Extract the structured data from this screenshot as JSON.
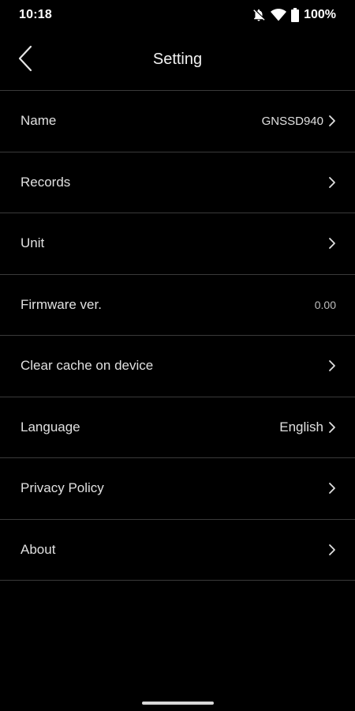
{
  "status_bar": {
    "time": "10:18",
    "battery": "100%",
    "icons": [
      "notifications-off-icon",
      "wifi-icon",
      "battery-icon"
    ]
  },
  "header": {
    "title": "Setting",
    "back_icon": "chevron-left-icon"
  },
  "settings": [
    {
      "label": "Name",
      "value": "GNSSD940",
      "chevron": true
    },
    {
      "label": "Records",
      "value": "",
      "chevron": true
    },
    {
      "label": "Unit",
      "value": "",
      "chevron": true
    },
    {
      "label": "Firmware ver.",
      "value": "0.00",
      "chevron": false
    },
    {
      "label": "Clear cache on device",
      "value": "",
      "chevron": true
    },
    {
      "label": "Language",
      "value": "English",
      "chevron": true
    },
    {
      "label": "Privacy Policy",
      "value": "",
      "chevron": true
    },
    {
      "label": "About",
      "value": "",
      "chevron": true
    }
  ],
  "colors": {
    "background": "#000000",
    "divider": "#3a3a3a",
    "text": "#e0e0e0"
  }
}
